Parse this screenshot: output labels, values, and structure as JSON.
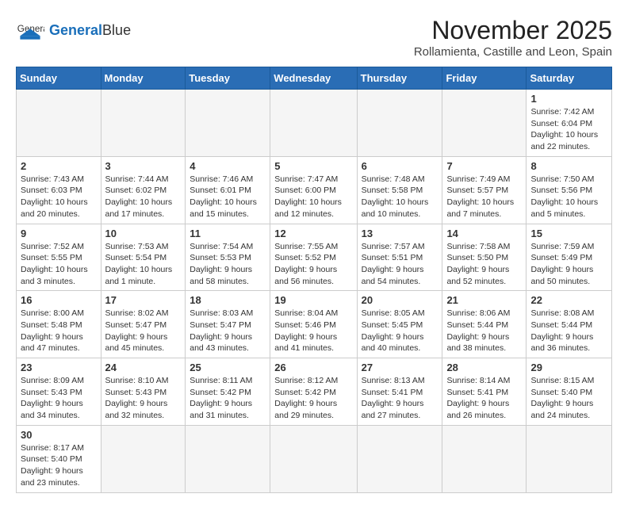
{
  "header": {
    "logo_general": "General",
    "logo_blue": "Blue",
    "month": "November 2025",
    "location": "Rollamienta, Castille and Leon, Spain"
  },
  "weekdays": [
    "Sunday",
    "Monday",
    "Tuesday",
    "Wednesday",
    "Thursday",
    "Friday",
    "Saturday"
  ],
  "days": [
    {
      "date": "",
      "info": ""
    },
    {
      "date": "",
      "info": ""
    },
    {
      "date": "",
      "info": ""
    },
    {
      "date": "",
      "info": ""
    },
    {
      "date": "",
      "info": ""
    },
    {
      "date": "",
      "info": ""
    },
    {
      "date": "1",
      "info": "Sunrise: 7:42 AM\nSunset: 6:04 PM\nDaylight: 10 hours and 22 minutes."
    },
    {
      "date": "2",
      "info": "Sunrise: 7:43 AM\nSunset: 6:03 PM\nDaylight: 10 hours and 20 minutes."
    },
    {
      "date": "3",
      "info": "Sunrise: 7:44 AM\nSunset: 6:02 PM\nDaylight: 10 hours and 17 minutes."
    },
    {
      "date": "4",
      "info": "Sunrise: 7:46 AM\nSunset: 6:01 PM\nDaylight: 10 hours and 15 minutes."
    },
    {
      "date": "5",
      "info": "Sunrise: 7:47 AM\nSunset: 6:00 PM\nDaylight: 10 hours and 12 minutes."
    },
    {
      "date": "6",
      "info": "Sunrise: 7:48 AM\nSunset: 5:58 PM\nDaylight: 10 hours and 10 minutes."
    },
    {
      "date": "7",
      "info": "Sunrise: 7:49 AM\nSunset: 5:57 PM\nDaylight: 10 hours and 7 minutes."
    },
    {
      "date": "8",
      "info": "Sunrise: 7:50 AM\nSunset: 5:56 PM\nDaylight: 10 hours and 5 minutes."
    },
    {
      "date": "9",
      "info": "Sunrise: 7:52 AM\nSunset: 5:55 PM\nDaylight: 10 hours and 3 minutes."
    },
    {
      "date": "10",
      "info": "Sunrise: 7:53 AM\nSunset: 5:54 PM\nDaylight: 10 hours and 1 minute."
    },
    {
      "date": "11",
      "info": "Sunrise: 7:54 AM\nSunset: 5:53 PM\nDaylight: 9 hours and 58 minutes."
    },
    {
      "date": "12",
      "info": "Sunrise: 7:55 AM\nSunset: 5:52 PM\nDaylight: 9 hours and 56 minutes."
    },
    {
      "date": "13",
      "info": "Sunrise: 7:57 AM\nSunset: 5:51 PM\nDaylight: 9 hours and 54 minutes."
    },
    {
      "date": "14",
      "info": "Sunrise: 7:58 AM\nSunset: 5:50 PM\nDaylight: 9 hours and 52 minutes."
    },
    {
      "date": "15",
      "info": "Sunrise: 7:59 AM\nSunset: 5:49 PM\nDaylight: 9 hours and 50 minutes."
    },
    {
      "date": "16",
      "info": "Sunrise: 8:00 AM\nSunset: 5:48 PM\nDaylight: 9 hours and 47 minutes."
    },
    {
      "date": "17",
      "info": "Sunrise: 8:02 AM\nSunset: 5:47 PM\nDaylight: 9 hours and 45 minutes."
    },
    {
      "date": "18",
      "info": "Sunrise: 8:03 AM\nSunset: 5:47 PM\nDaylight: 9 hours and 43 minutes."
    },
    {
      "date": "19",
      "info": "Sunrise: 8:04 AM\nSunset: 5:46 PM\nDaylight: 9 hours and 41 minutes."
    },
    {
      "date": "20",
      "info": "Sunrise: 8:05 AM\nSunset: 5:45 PM\nDaylight: 9 hours and 40 minutes."
    },
    {
      "date": "21",
      "info": "Sunrise: 8:06 AM\nSunset: 5:44 PM\nDaylight: 9 hours and 38 minutes."
    },
    {
      "date": "22",
      "info": "Sunrise: 8:08 AM\nSunset: 5:44 PM\nDaylight: 9 hours and 36 minutes."
    },
    {
      "date": "23",
      "info": "Sunrise: 8:09 AM\nSunset: 5:43 PM\nDaylight: 9 hours and 34 minutes."
    },
    {
      "date": "24",
      "info": "Sunrise: 8:10 AM\nSunset: 5:43 PM\nDaylight: 9 hours and 32 minutes."
    },
    {
      "date": "25",
      "info": "Sunrise: 8:11 AM\nSunset: 5:42 PM\nDaylight: 9 hours and 31 minutes."
    },
    {
      "date": "26",
      "info": "Sunrise: 8:12 AM\nSunset: 5:42 PM\nDaylight: 9 hours and 29 minutes."
    },
    {
      "date": "27",
      "info": "Sunrise: 8:13 AM\nSunset: 5:41 PM\nDaylight: 9 hours and 27 minutes."
    },
    {
      "date": "28",
      "info": "Sunrise: 8:14 AM\nSunset: 5:41 PM\nDaylight: 9 hours and 26 minutes."
    },
    {
      "date": "29",
      "info": "Sunrise: 8:15 AM\nSunset: 5:40 PM\nDaylight: 9 hours and 24 minutes."
    },
    {
      "date": "30",
      "info": "Sunrise: 8:17 AM\nSunset: 5:40 PM\nDaylight: 9 hours and 23 minutes."
    }
  ]
}
